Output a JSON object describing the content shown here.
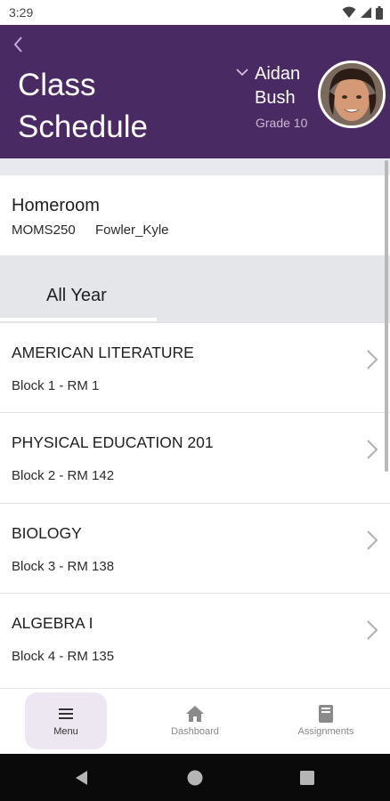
{
  "status_bar": {
    "time": "3:29"
  },
  "header": {
    "title": "Class Schedule",
    "user_name": "Aidan Bush",
    "grade": "Grade 10",
    "background_color": "#4a2a63"
  },
  "homeroom": {
    "title": "Homeroom",
    "code": "MOMS250",
    "teacher": "Fowler_Kyle"
  },
  "tabs": [
    {
      "label": "All Year",
      "selected": true
    }
  ],
  "courses": [
    {
      "name": "AMERICAN LITERATURE",
      "location": "Block 1 - RM 1"
    },
    {
      "name": "PHYSICAL EDUCATION 201",
      "location": "Block 2 - RM 142"
    },
    {
      "name": "BIOLOGY",
      "location": "Block 3 - RM 138"
    },
    {
      "name": "ALGEBRA I",
      "location": "Block 4 - RM 135"
    }
  ],
  "bottom_nav": [
    {
      "label": "Menu",
      "icon": "menu-icon",
      "active": true
    },
    {
      "label": "Dashboard",
      "icon": "home-icon",
      "active": false
    },
    {
      "label": "Assignments",
      "icon": "book-icon",
      "active": false
    }
  ],
  "system_nav": {
    "icons": [
      "back-triangle-icon",
      "home-circle-icon",
      "recents-square-icon"
    ]
  }
}
